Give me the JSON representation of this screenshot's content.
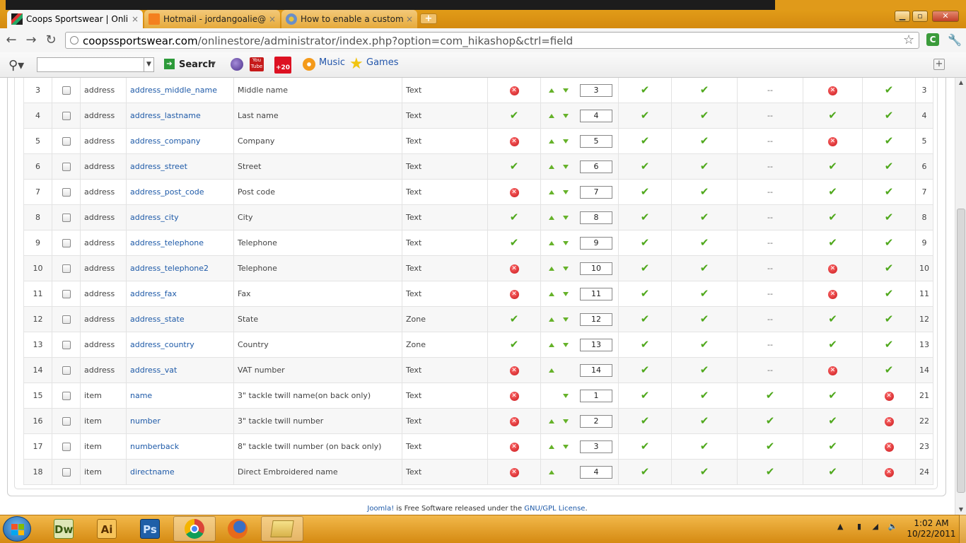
{
  "browser": {
    "tabs": [
      {
        "title": "Coops Sportswear | Online S",
        "close": "×",
        "active": true
      },
      {
        "title": "Hotmail - jordangoalie@live",
        "close": "×",
        "active": false
      },
      {
        "title": "How to enable a custom fie",
        "close": "×",
        "active": false
      }
    ],
    "new_tab": "+",
    "window_buttons": {
      "minimize": "▁",
      "maximize": "▫",
      "close": "✕"
    },
    "url_host": "coopssportswear.com",
    "url_path": "/onlinestore/administrator/index.php?option=com_hikashop&ctrl=field",
    "nav": {
      "back": "←",
      "forward": "→",
      "reload": "↻"
    }
  },
  "toolbar": {
    "search_label": "Search",
    "music_label": "Music",
    "games_label": "Games",
    "badge": "+20",
    "youtube_label": "You Tube"
  },
  "rows": [
    {
      "n": "3",
      "table": "address",
      "column": "address_middle_name",
      "label": "Middle name",
      "type": "Text",
      "required": "no",
      "up": true,
      "down": true,
      "order": "3",
      "c1": "ok",
      "c2": "ok",
      "c3": "--",
      "c4": "no",
      "c5": "ok",
      "id": "3"
    },
    {
      "n": "4",
      "table": "address",
      "column": "address_lastname",
      "label": "Last name",
      "type": "Text",
      "required": "ok",
      "up": true,
      "down": true,
      "order": "4",
      "c1": "ok",
      "c2": "ok",
      "c3": "--",
      "c4": "ok",
      "c5": "ok",
      "id": "4"
    },
    {
      "n": "5",
      "table": "address",
      "column": "address_company",
      "label": "Company",
      "type": "Text",
      "required": "no",
      "up": true,
      "down": true,
      "order": "5",
      "c1": "ok",
      "c2": "ok",
      "c3": "--",
      "c4": "no",
      "c5": "ok",
      "id": "5"
    },
    {
      "n": "6",
      "table": "address",
      "column": "address_street",
      "label": "Street",
      "type": "Text",
      "required": "ok",
      "up": true,
      "down": true,
      "order": "6",
      "c1": "ok",
      "c2": "ok",
      "c3": "--",
      "c4": "ok",
      "c5": "ok",
      "id": "6"
    },
    {
      "n": "7",
      "table": "address",
      "column": "address_post_code",
      "label": "Post code",
      "type": "Text",
      "required": "no",
      "up": true,
      "down": true,
      "order": "7",
      "c1": "ok",
      "c2": "ok",
      "c3": "--",
      "c4": "ok",
      "c5": "ok",
      "id": "7"
    },
    {
      "n": "8",
      "table": "address",
      "column": "address_city",
      "label": "City",
      "type": "Text",
      "required": "ok",
      "up": true,
      "down": true,
      "order": "8",
      "c1": "ok",
      "c2": "ok",
      "c3": "--",
      "c4": "ok",
      "c5": "ok",
      "id": "8"
    },
    {
      "n": "9",
      "table": "address",
      "column": "address_telephone",
      "label": "Telephone",
      "type": "Text",
      "required": "ok",
      "up": true,
      "down": true,
      "order": "9",
      "c1": "ok",
      "c2": "ok",
      "c3": "--",
      "c4": "ok",
      "c5": "ok",
      "id": "9"
    },
    {
      "n": "10",
      "table": "address",
      "column": "address_telephone2",
      "label": "Telephone",
      "type": "Text",
      "required": "no",
      "up": true,
      "down": true,
      "order": "10",
      "c1": "ok",
      "c2": "ok",
      "c3": "--",
      "c4": "no",
      "c5": "ok",
      "id": "10"
    },
    {
      "n": "11",
      "table": "address",
      "column": "address_fax",
      "label": "Fax",
      "type": "Text",
      "required": "no",
      "up": true,
      "down": true,
      "order": "11",
      "c1": "ok",
      "c2": "ok",
      "c3": "--",
      "c4": "no",
      "c5": "ok",
      "id": "11"
    },
    {
      "n": "12",
      "table": "address",
      "column": "address_state",
      "label": "State",
      "type": "Zone",
      "required": "ok",
      "up": true,
      "down": true,
      "order": "12",
      "c1": "ok",
      "c2": "ok",
      "c3": "--",
      "c4": "ok",
      "c5": "ok",
      "id": "12"
    },
    {
      "n": "13",
      "table": "address",
      "column": "address_country",
      "label": "Country",
      "type": "Zone",
      "required": "ok",
      "up": true,
      "down": true,
      "order": "13",
      "c1": "ok",
      "c2": "ok",
      "c3": "--",
      "c4": "ok",
      "c5": "ok",
      "id": "13"
    },
    {
      "n": "14",
      "table": "address",
      "column": "address_vat",
      "label": "VAT number",
      "type": "Text",
      "required": "no",
      "up": true,
      "down": false,
      "order": "14",
      "c1": "ok",
      "c2": "ok",
      "c3": "--",
      "c4": "no",
      "c5": "ok",
      "id": "14"
    },
    {
      "n": "15",
      "table": "item",
      "column": "name",
      "label": "3\" tackle twill name(on back only)",
      "type": "Text",
      "required": "no",
      "up": false,
      "down": true,
      "order": "1",
      "c1": "ok",
      "c2": "ok",
      "c3": "ok",
      "c4": "ok",
      "c5": "no",
      "id": "21"
    },
    {
      "n": "16",
      "table": "item",
      "column": "number",
      "label": "3\" tackle twill number",
      "type": "Text",
      "required": "no",
      "up": true,
      "down": true,
      "order": "2",
      "c1": "ok",
      "c2": "ok",
      "c3": "ok",
      "c4": "ok",
      "c5": "no",
      "id": "22"
    },
    {
      "n": "17",
      "table": "item",
      "column": "numberback",
      "label": "8\" tackle twill number (on back only)",
      "type": "Text",
      "required": "no",
      "up": true,
      "down": true,
      "order": "3",
      "c1": "ok",
      "c2": "ok",
      "c3": "ok",
      "c4": "ok",
      "c5": "no",
      "id": "23"
    },
    {
      "n": "18",
      "table": "item",
      "column": "directname",
      "label": "Direct Embroidered name",
      "type": "Text",
      "required": "no",
      "up": true,
      "down": false,
      "order": "4",
      "c1": "ok",
      "c2": "ok",
      "c3": "ok",
      "c4": "ok",
      "c5": "no",
      "id": "24"
    }
  ],
  "footer": {
    "joomla_link": "Joomla!",
    "text": " is Free Software released under the ",
    "license_link": "GNU/GPL License",
    "end": "."
  },
  "taskbar": {
    "apps": [
      {
        "name": "Dreamweaver",
        "abbr": "Dw"
      },
      {
        "name": "Illustrator",
        "abbr": "Ai"
      },
      {
        "name": "Photoshop",
        "abbr": "Ps"
      }
    ],
    "time": "1:02 AM",
    "date": "10/22/2011"
  },
  "colors": {
    "accent": "#e8a51c",
    "link": "#1e5aa8",
    "check": "#4fa81c",
    "error": "#c8171b"
  }
}
